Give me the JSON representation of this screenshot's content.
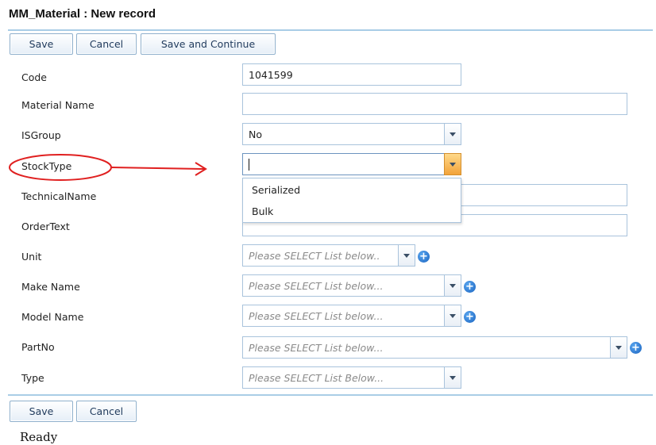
{
  "page": {
    "title": "MM_Material : New record",
    "status": "Ready"
  },
  "top_toolbar": {
    "save": "Save",
    "cancel": "Cancel",
    "save_continue": "Save and Continue"
  },
  "bottom_toolbar": {
    "save": "Save",
    "cancel": "Cancel"
  },
  "fields": {
    "code": {
      "label": "Code",
      "value": "1041599"
    },
    "material_name": {
      "label": "Material Name",
      "value": ""
    },
    "isgroup": {
      "label": "ISGroup",
      "value": "No"
    },
    "stocktype": {
      "label": "StockType",
      "value": "",
      "options": [
        "Serialized",
        "Bulk"
      ]
    },
    "technical_name": {
      "label": "TechnicalName",
      "value": ""
    },
    "order_text": {
      "label": "OrderText",
      "value": ""
    },
    "unit": {
      "label": "Unit",
      "placeholder": "Please SELECT List below.."
    },
    "make_name": {
      "label": "Make Name",
      "placeholder": "Please SELECT List below..."
    },
    "model_name": {
      "label": "Model Name",
      "placeholder": "Please SELECT List below..."
    },
    "partno": {
      "label": "PartNo",
      "placeholder": "Please SELECT List below..."
    },
    "type": {
      "label": "Type",
      "placeholder": "Please SELECT List Below..."
    }
  },
  "colors": {
    "annotation": "#e02020",
    "focus_button": "#f2a33a",
    "border": "#a9c3dc"
  }
}
